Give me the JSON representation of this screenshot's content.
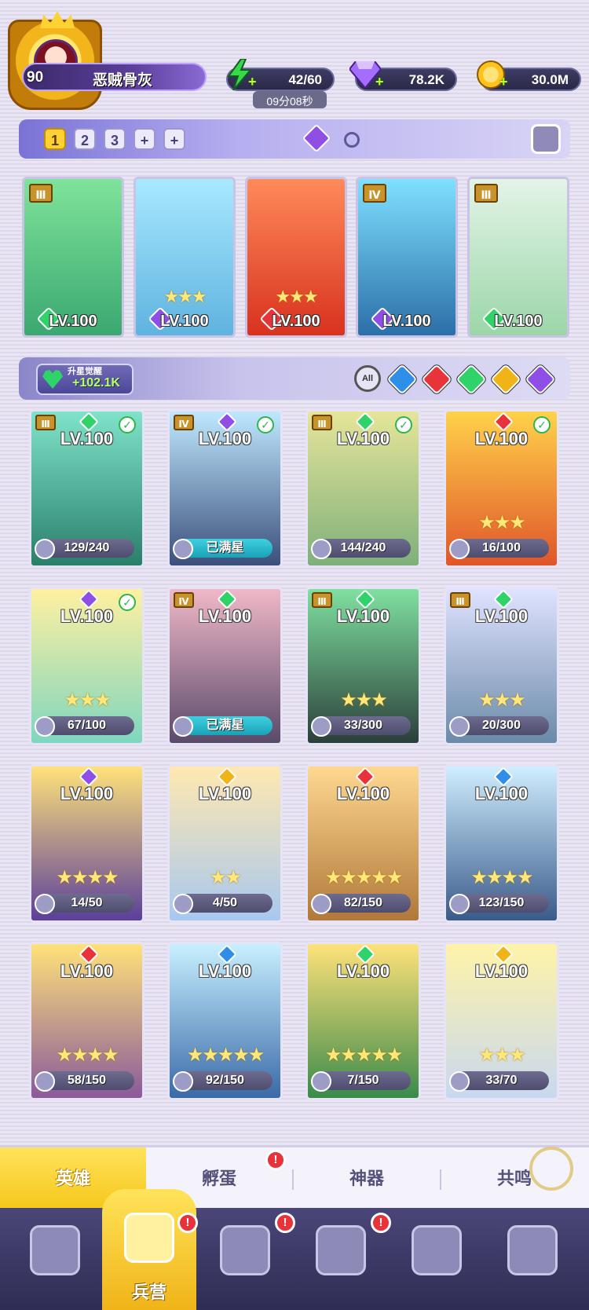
{
  "player": {
    "level": "90",
    "name": "恶贼骨灰"
  },
  "resources": {
    "energy": {
      "icon": "lightning-icon",
      "value": "42/60",
      "timer": "09分08秒",
      "color": "#37d94a"
    },
    "gems": {
      "icon": "diamond-icon",
      "value": "78.2K",
      "color": "#a46cff"
    },
    "gold": {
      "icon": "coin-icon",
      "value": "30.0M",
      "color": "#ffc21a"
    }
  },
  "team_tabs": [
    "1",
    "2",
    "3",
    "+",
    "+"
  ],
  "team_tab_active": "1",
  "team": [
    {
      "tier": "Ⅲ",
      "level": "LV.100",
      "element": "#2fd36a",
      "stars": "",
      "bg": "linear-gradient(180deg,#7fe39a,#3aa870)"
    },
    {
      "tier": "",
      "level": "LV.100",
      "element": "#8f4ee6",
      "stars": "★★★",
      "bg": "linear-gradient(180deg,#a8e9ff,#5fb3e0)"
    },
    {
      "tier": "",
      "level": "LV.100",
      "element": "#e8333a",
      "stars": "★★★",
      "bg": "linear-gradient(180deg,#ff8a5a,#d8321e)"
    },
    {
      "tier": "Ⅳ",
      "level": "LV.100",
      "element": "#8f4ee6",
      "stars": "",
      "bg": "linear-gradient(180deg,#7fe0ff,#2b6fa8)"
    },
    {
      "tier": "Ⅲ",
      "level": "LV.100",
      "element": "#2fd36a",
      "stars": "",
      "bg": "linear-gradient(180deg,#e3f4e8,#9bd6a8)"
    }
  ],
  "awaken": {
    "title": "升星觉醒",
    "value": "+102.1K"
  },
  "filters": {
    "all_label": "All",
    "chips": [
      {
        "name": "water-element-icon",
        "color": "#2e8ee8"
      },
      {
        "name": "fire-element-icon",
        "color": "#e8333a"
      },
      {
        "name": "wind-element-icon",
        "color": "#2fd36a"
      },
      {
        "name": "light-element-icon",
        "color": "#f0b418"
      },
      {
        "name": "dark-element-icon",
        "color": "#8f4ee6"
      }
    ]
  },
  "heroes": [
    {
      "level": "LV.100",
      "tier": "Ⅲ",
      "element": "#2fd36a",
      "check": true,
      "stars": "",
      "progress": "129/240",
      "full": false,
      "bg": "linear-gradient(180deg,#7fe3c9,#2a7f6a)"
    },
    {
      "level": "LV.100",
      "tier": "Ⅳ",
      "element": "#8f4ee6",
      "check": true,
      "stars": "",
      "progress": "已满星",
      "full": true,
      "bg": "linear-gradient(180deg,#bfe8ff,#3b4f7a)"
    },
    {
      "level": "LV.100",
      "tier": "Ⅲ",
      "element": "#2fd36a",
      "check": true,
      "stars": "",
      "progress": "144/240",
      "full": false,
      "bg": "linear-gradient(180deg,#e6e59a,#7fb07a)"
    },
    {
      "level": "LV.100",
      "tier": "",
      "element": "#e8333a",
      "check": true,
      "stars": "★★★",
      "progress": "16/100",
      "full": false,
      "bg": "linear-gradient(180deg,#ffd24a,#e0552a)"
    },
    {
      "level": "LV.100",
      "tier": "",
      "element": "#8f4ee6",
      "check": true,
      "stars": "★★★",
      "progress": "67/100",
      "full": false,
      "bg": "linear-gradient(180deg,#fff0a0,#7fd6c0)"
    },
    {
      "level": "LV.100",
      "tier": "Ⅳ",
      "element": "#2fd36a",
      "check": false,
      "stars": "",
      "progress": "已满星",
      "full": true,
      "bg": "linear-gradient(180deg,#f0b8c8,#5a4a6a)"
    },
    {
      "level": "LV.100",
      "tier": "Ⅲ",
      "element": "#2fd36a",
      "check": false,
      "stars": "★★★",
      "progress": "33/300",
      "full": false,
      "bg": "linear-gradient(180deg,#7fe0a0,#2b3f3a)"
    },
    {
      "level": "LV.100",
      "tier": "Ⅲ",
      "element": "#2fd36a",
      "check": false,
      "stars": "★★★",
      "progress": "20/300",
      "full": false,
      "bg": "linear-gradient(180deg,#dfe3ff,#6a8aa8)"
    },
    {
      "level": "LV.100",
      "tier": "",
      "element": "#8f4ee6",
      "check": false,
      "stars": "★★★★",
      "progress": "14/50",
      "full": false,
      "bg": "linear-gradient(180deg,#ffe27a,#5b3f9a)"
    },
    {
      "level": "LV.100",
      "tier": "",
      "element": "#f0b418",
      "check": false,
      "stars": "★★",
      "progress": "4/50",
      "full": false,
      "bg": "linear-gradient(180deg,#ffe8b0,#a8c8f0)"
    },
    {
      "level": "LV.100",
      "tier": "",
      "element": "#e8333a",
      "check": false,
      "stars": "★★★★★",
      "progress": "82/150",
      "full": false,
      "bg": "linear-gradient(180deg,#ffd890,#b0783a)"
    },
    {
      "level": "LV.100",
      "tier": "",
      "element": "#2e8ee8",
      "check": false,
      "stars": "★★★★",
      "progress": "123/150",
      "full": false,
      "bg": "linear-gradient(180deg,#cfeeff,#3a5a8a)"
    },
    {
      "level": "LV.100",
      "tier": "",
      "element": "#e8333a",
      "check": false,
      "stars": "★★★★",
      "progress": "58/150",
      "full": false,
      "bg": "linear-gradient(180deg,#ffe27a,#8a5a9a)"
    },
    {
      "level": "LV.100",
      "tier": "",
      "element": "#2e8ee8",
      "check": false,
      "stars": "★★★★★",
      "progress": "92/150",
      "full": false,
      "bg": "linear-gradient(180deg,#c8f0ff,#3a6aa8)"
    },
    {
      "level": "LV.100",
      "tier": "",
      "element": "#2fd36a",
      "check": false,
      "stars": "★★★★★",
      "progress": "7/150",
      "full": false,
      "bg": "linear-gradient(180deg,#ffe27a,#3a8a4a)"
    },
    {
      "level": "LV.100",
      "tier": "",
      "element": "#f0b418",
      "check": false,
      "stars": "★★★",
      "progress": "33/70",
      "full": false,
      "bg": "linear-gradient(180deg,#fff3a8,#c8d8f0)"
    }
  ],
  "subtabs": [
    "英雄",
    "孵蛋",
    "神器",
    "共鸣"
  ],
  "subtab_active": "英雄",
  "nav": [
    {
      "icon": "cards-icon",
      "label": "",
      "badge": ""
    },
    {
      "icon": "barracks-icon",
      "label": "兵营",
      "badge": "!"
    },
    {
      "icon": "book-icon",
      "label": "",
      "badge": "!"
    },
    {
      "icon": "shop-icon",
      "label": "",
      "badge": "!"
    },
    {
      "icon": "summon-icon",
      "label": "",
      "badge": ""
    },
    {
      "icon": "guild-icon",
      "label": "",
      "badge": ""
    }
  ],
  "nav_active": "兵营",
  "subtab_badge": "!"
}
